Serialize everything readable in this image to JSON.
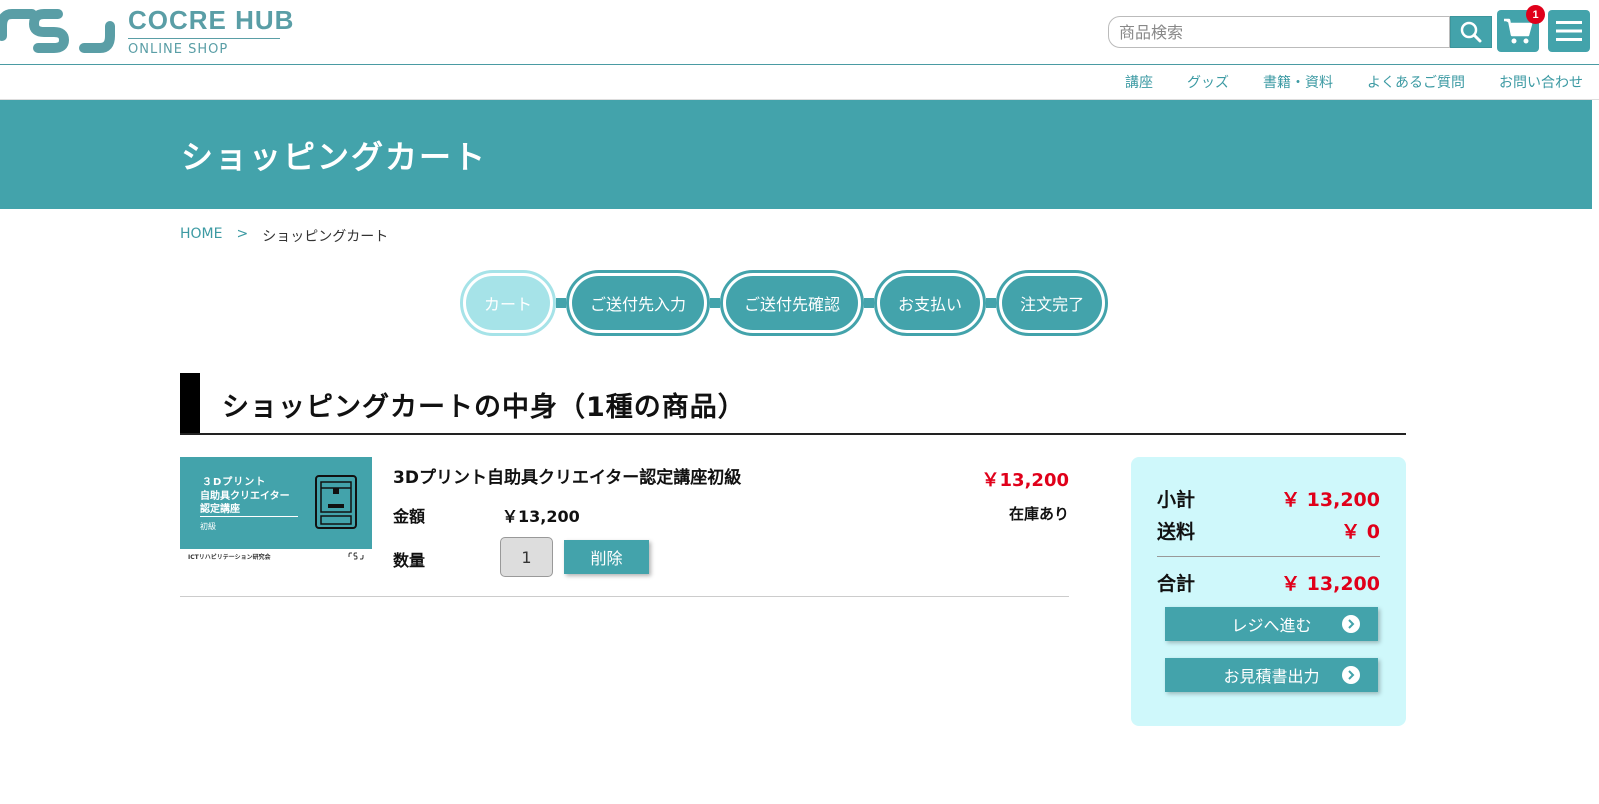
{
  "header": {
    "logo_title": "COCRE HUB",
    "logo_subtitle": "ONLINE SHOP",
    "search_placeholder": "商品検索",
    "cart_count": "1"
  },
  "nav": {
    "items": [
      "講座",
      "グッズ",
      "書籍・資料",
      "よくあるご質問",
      "お問い合わせ"
    ]
  },
  "hero": {
    "title": "ショッピングカート"
  },
  "breadcrumb": {
    "home": "HOME",
    "separator": ">",
    "current": "ショッピングカート"
  },
  "steps": [
    "カート",
    "ご送付先入力",
    "ご送付先確認",
    "お支払い",
    "注文完了"
  ],
  "section": {
    "title": "ショッピングカートの中身（1種の商品）"
  },
  "item": {
    "thumb_line1": "３Dプリント",
    "thumb_line2": "自助具クリエイター",
    "thumb_line3": "認定講座",
    "thumb_level": "初級",
    "thumb_org": "ICTリハビリテーション研究会",
    "name": "3Dプリント自助具クリエイター認定講座初級",
    "price": "￥13,200",
    "amount_label": "金額",
    "amount": "￥13,200",
    "stock": "在庫あり",
    "qty_label": "数量",
    "qty": "1",
    "delete_label": "削除"
  },
  "summary": {
    "subtotal_label": "小計",
    "subtotal": "￥ 13,200",
    "shipping_label": "送料",
    "shipping": "￥ 0",
    "total_label": "合計",
    "total": "￥ 13,200",
    "checkout_label": "レジへ進む",
    "estimate_label": "お見積書出力"
  },
  "colors": {
    "accent": "#43a3ab",
    "price": "#e0001a",
    "summary_bg": "#cff8fb",
    "active_step": "#a6e3e8"
  }
}
